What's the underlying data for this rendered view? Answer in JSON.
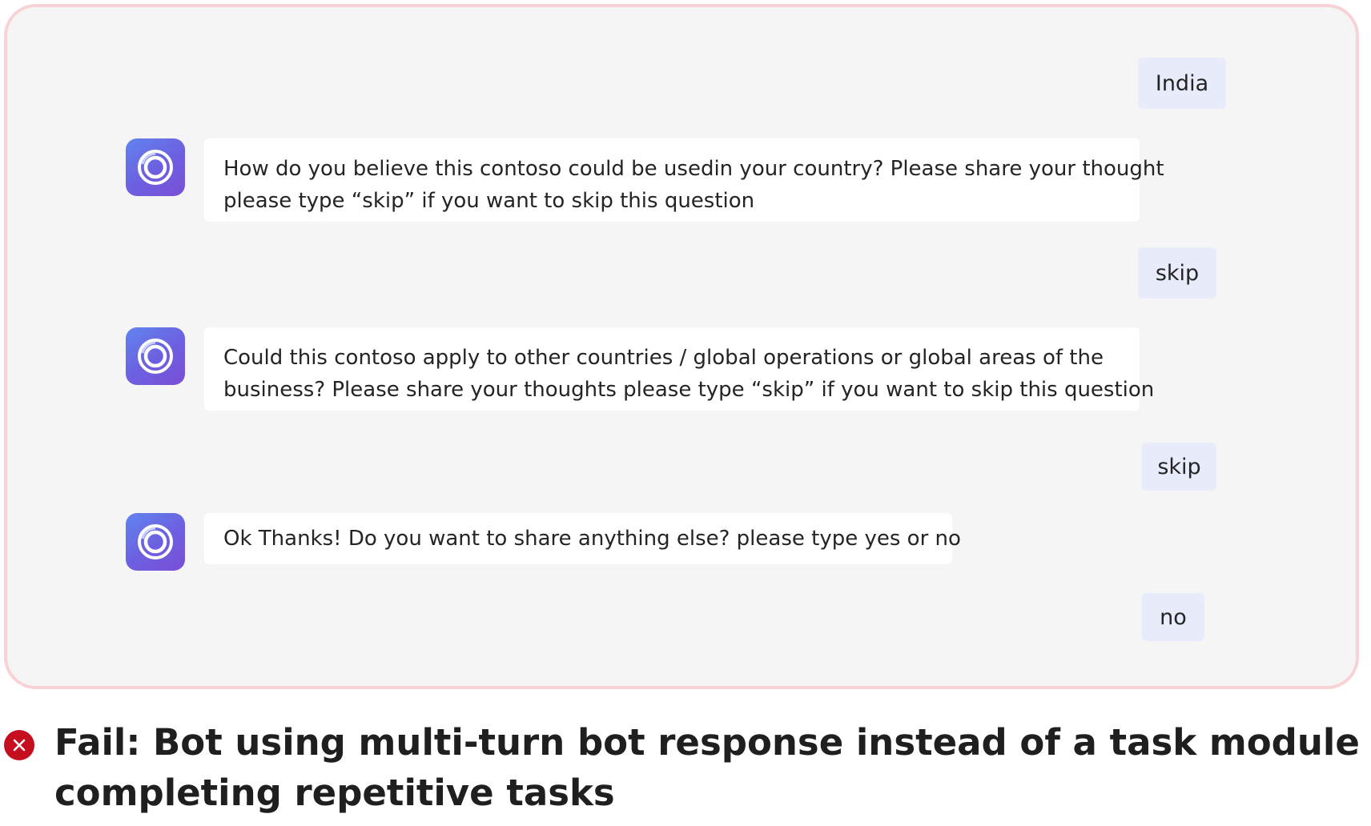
{
  "conversation": {
    "messages": [
      {
        "sender": "user",
        "text": "India"
      },
      {
        "sender": "bot",
        "icon": "bot-ring-icon",
        "lines": [
          "How do you believe this contoso could be usedin your country? Please share your thought",
          "please type “skip” if you want to skip this question"
        ]
      },
      {
        "sender": "user",
        "text": "skip"
      },
      {
        "sender": "bot",
        "icon": "bot-ring-icon",
        "lines": [
          "Could this contoso apply to other countries / global operations or global areas of the",
          "business? Please share your thoughts please type “skip” if you want to skip this question"
        ]
      },
      {
        "sender": "user",
        "text": "skip"
      },
      {
        "sender": "bot",
        "icon": "bot-ring-icon",
        "lines": [
          "Ok Thanks! Do you want to share anything else? please type yes or no"
        ]
      },
      {
        "sender": "user",
        "text": "no"
      }
    ]
  },
  "caption": {
    "status_icon": "fail-x-icon",
    "lines": [
      "Fail: Bot using multi-turn bot response instead of a task module for",
      "completing repetitive tasks"
    ]
  },
  "colors": {
    "frame_border": "#f9d2d6",
    "frame_background": "#f5f5f5",
    "user_bubble": "#e8ebfa",
    "bot_bubble": "#ffffff",
    "bot_avatar": "#6d5fe0",
    "fail_red": "#c50f1f"
  }
}
